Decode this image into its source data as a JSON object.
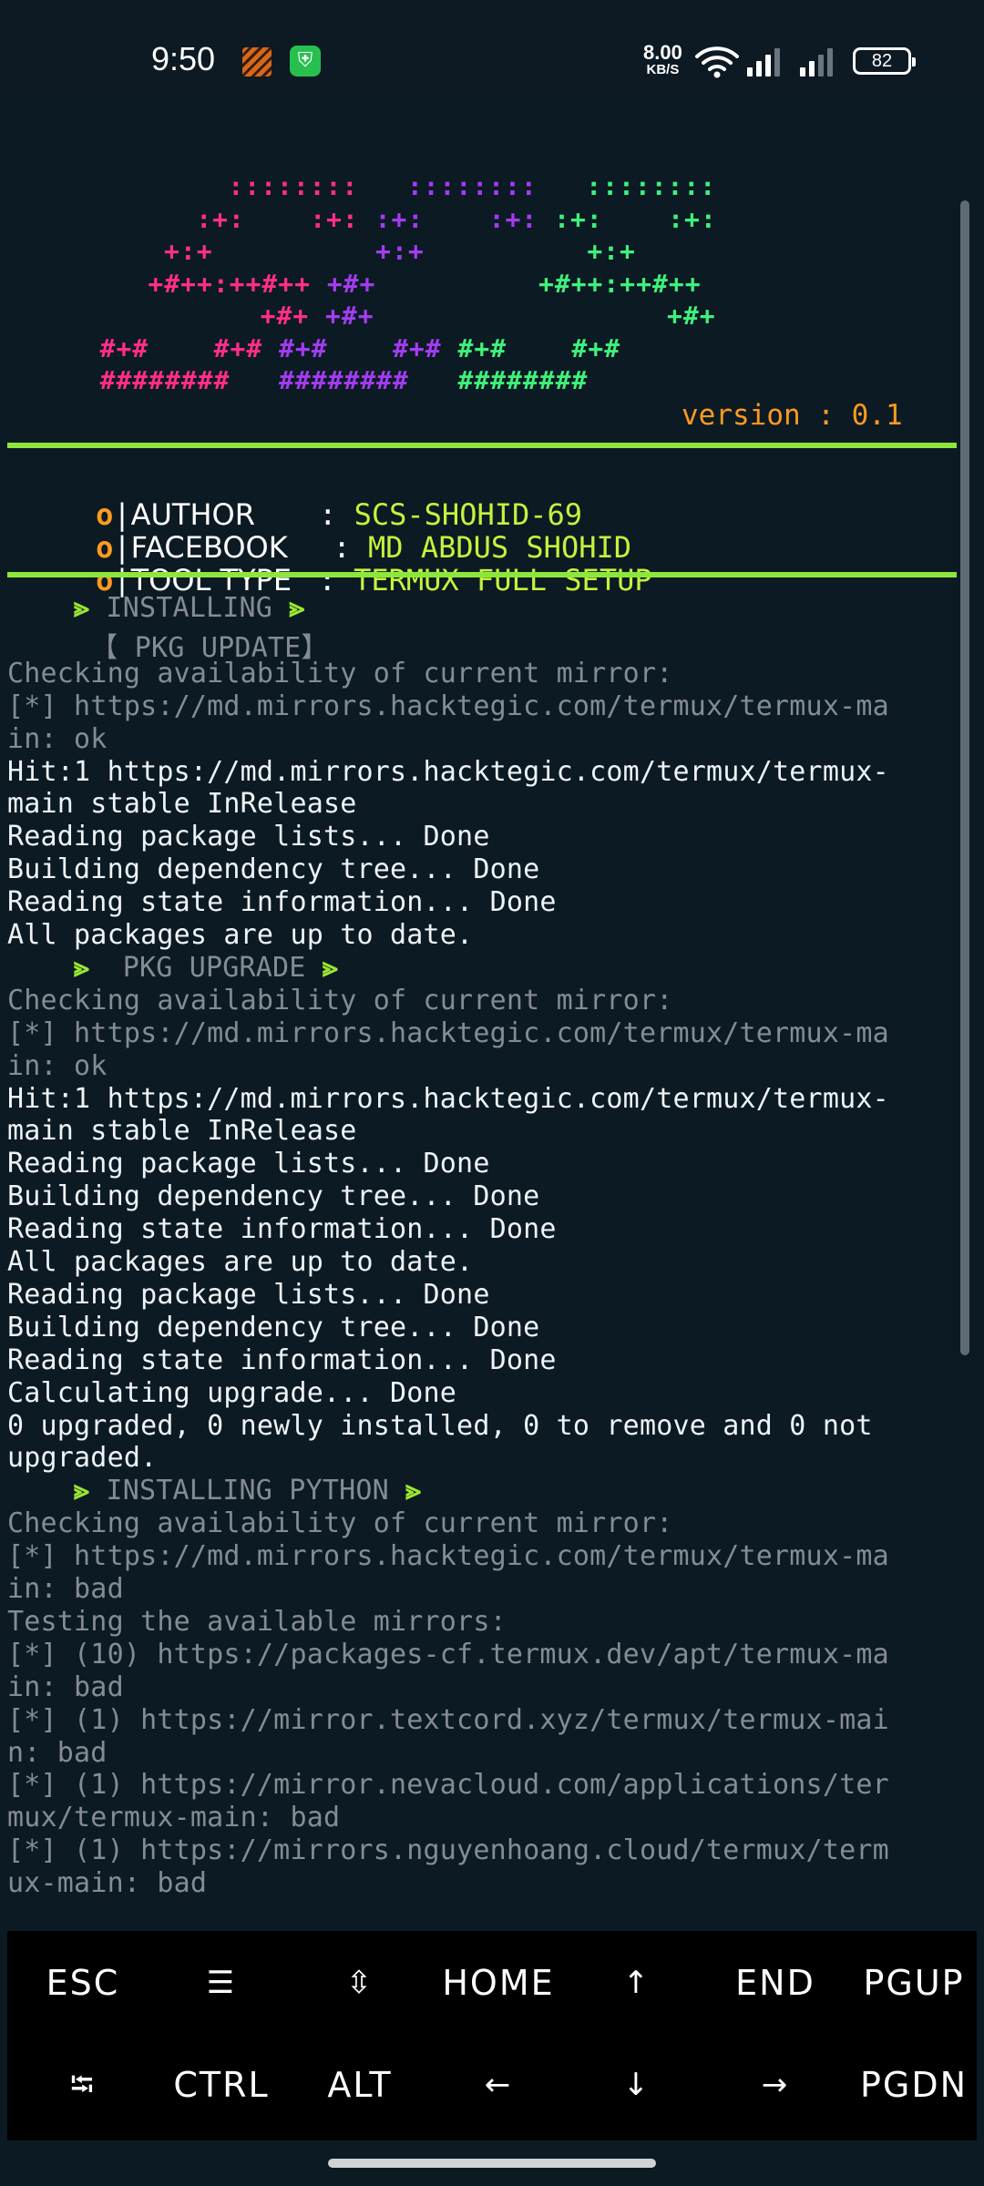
{
  "status_bar": {
    "time": "9:50",
    "net_speed_value": "8.00",
    "net_speed_unit": "KB/S",
    "battery": "82",
    "icons": [
      "striped-app-icon",
      "shield-app-icon",
      "wifi-icon",
      "signal-icon",
      "signal-icon-2",
      "battery-icon"
    ]
  },
  "banner": {
    "art_rows": [
      {
        "segments": [
          {
            "t": "::::::::",
            "c": "pink"
          },
          {
            "t": "   ",
            "c": ""
          },
          {
            "t": "::::::::",
            "c": "purple"
          },
          {
            "t": "   ",
            "c": ""
          },
          {
            "t": "::::::::",
            "c": "green"
          }
        ],
        "indent": 14
      },
      {
        "segments": [
          {
            "t": ":+:",
            "c": "pink"
          },
          {
            "t": "    ",
            "c": ""
          },
          {
            "t": ":+:",
            "c": "pink"
          },
          {
            "t": " ",
            "c": ""
          },
          {
            "t": ":+:",
            "c": "purple"
          },
          {
            "t": "    ",
            "c": ""
          },
          {
            "t": ":+:",
            "c": "purple"
          },
          {
            "t": " ",
            "c": ""
          },
          {
            "t": ":+:",
            "c": "green"
          },
          {
            "t": "    ",
            "c": ""
          },
          {
            "t": ":+:",
            "c": "green"
          }
        ],
        "indent": 12
      },
      {
        "segments": [
          {
            "t": "+:+",
            "c": "pink"
          },
          {
            "t": "          ",
            "c": ""
          },
          {
            "t": "+:+",
            "c": "purple"
          },
          {
            "t": "          ",
            "c": ""
          },
          {
            "t": "+:+",
            "c": "green"
          }
        ],
        "indent": 10
      },
      {
        "segments": [
          {
            "t": "+#++:++#++",
            "c": "pink"
          },
          {
            "t": " ",
            "c": ""
          },
          {
            "t": "+#+",
            "c": "purple"
          },
          {
            "t": "          ",
            "c": ""
          },
          {
            "t": "+#++:++#++",
            "c": "green"
          }
        ],
        "indent": 9
      },
      {
        "segments": [
          {
            "t": "+#+",
            "c": "pink"
          },
          {
            "t": " ",
            "c": ""
          },
          {
            "t": "+#+",
            "c": "purple"
          },
          {
            "t": "                  ",
            "c": ""
          },
          {
            "t": "+#+",
            "c": "green"
          }
        ],
        "indent": 16
      },
      {
        "segments": [
          {
            "t": "#+#",
            "c": "pink"
          },
          {
            "t": "    ",
            "c": ""
          },
          {
            "t": "#+#",
            "c": "pink"
          },
          {
            "t": " ",
            "c": ""
          },
          {
            "t": "#+#",
            "c": "purple"
          },
          {
            "t": "    ",
            "c": ""
          },
          {
            "t": "#+#",
            "c": "purple"
          },
          {
            "t": " ",
            "c": ""
          },
          {
            "t": "#+#",
            "c": "green"
          },
          {
            "t": "    ",
            "c": ""
          },
          {
            "t": "#+#",
            "c": "green"
          }
        ],
        "indent": 6
      },
      {
        "segments": [
          {
            "t": "########",
            "c": "pink"
          },
          {
            "t": "   ",
            "c": ""
          },
          {
            "t": "########",
            "c": "purple"
          },
          {
            "t": "   ",
            "c": ""
          },
          {
            "t": "########",
            "c": "green"
          }
        ],
        "indent": 6
      }
    ],
    "version": "version : 0.1"
  },
  "info": [
    {
      "key": "AUTHOR     ",
      "value": "SCS-SHOHID-69"
    },
    {
      "key": "FACEBOOK   ",
      "value": "MD ABDUS SHOHID"
    },
    {
      "key": "TOOL TYPE ",
      "value": "TERMUX FULL SETUP"
    }
  ],
  "terminal_lines": [
    {
      "text": "    ⪢ INSTALLING ⪢",
      "style": "head"
    },
    {
      "text": "     【 PKG UPDATE】",
      "style": "gray"
    },
    {
      "text": "Checking availability of current mirror:",
      "style": "gray"
    },
    {
      "text": "[*] https://md.mirrors.hacktegic.com/termux/termux-ma",
      "style": "gray"
    },
    {
      "text": "in: ok",
      "style": "gray"
    },
    {
      "text": "Hit:1 https://md.mirrors.hacktegic.com/termux/termux-",
      "style": "white"
    },
    {
      "text": "main stable InRelease",
      "style": "white"
    },
    {
      "text": "Reading package lists... Done",
      "style": "white"
    },
    {
      "text": "Building dependency tree... Done",
      "style": "white"
    },
    {
      "text": "Reading state information... Done",
      "style": "white"
    },
    {
      "text": "All packages are up to date.",
      "style": "white"
    },
    {
      "text": "    ⪢  PKG UPGRADE ⪢",
      "style": "head"
    },
    {
      "text": "Checking availability of current mirror:",
      "style": "gray"
    },
    {
      "text": "[*] https://md.mirrors.hacktegic.com/termux/termux-ma",
      "style": "gray"
    },
    {
      "text": "in: ok",
      "style": "gray"
    },
    {
      "text": "Hit:1 https://md.mirrors.hacktegic.com/termux/termux-",
      "style": "white"
    },
    {
      "text": "main stable InRelease",
      "style": "white"
    },
    {
      "text": "Reading package lists... Done",
      "style": "white"
    },
    {
      "text": "Building dependency tree... Done",
      "style": "white"
    },
    {
      "text": "Reading state information... Done",
      "style": "white"
    },
    {
      "text": "All packages are up to date.",
      "style": "white"
    },
    {
      "text": "Reading package lists... Done",
      "style": "white"
    },
    {
      "text": "Building dependency tree... Done",
      "style": "white"
    },
    {
      "text": "Reading state information... Done",
      "style": "white"
    },
    {
      "text": "Calculating upgrade... Done",
      "style": "white"
    },
    {
      "text": "0 upgraded, 0 newly installed, 0 to remove and 0 not",
      "style": "white"
    },
    {
      "text": "upgraded.",
      "style": "white"
    },
    {
      "text": "    ⪢ INSTALLING PYTHON ⪢",
      "style": "head"
    },
    {
      "text": "Checking availability of current mirror:",
      "style": "gray"
    },
    {
      "text": "[*] https://md.mirrors.hacktegic.com/termux/termux-ma",
      "style": "gray"
    },
    {
      "text": "in: bad",
      "style": "gray"
    },
    {
      "text": "Testing the available mirrors:",
      "style": "gray"
    },
    {
      "text": "[*] (10) https://packages-cf.termux.dev/apt/termux-ma",
      "style": "gray"
    },
    {
      "text": "in: bad",
      "style": "gray"
    },
    {
      "text": "[*] (1) https://mirror.textcord.xyz/termux/termux-mai",
      "style": "gray"
    },
    {
      "text": "n: bad",
      "style": "gray"
    },
    {
      "text": "[*] (1) https://mirror.nevacloud.com/applications/ter",
      "style": "gray"
    },
    {
      "text": "mux/termux-main: bad",
      "style": "gray"
    },
    {
      "text": "[*] (1) https://mirrors.nguyenhoang.cloud/termux/term",
      "style": "gray"
    },
    {
      "text": "ux-main: bad",
      "style": "gray"
    }
  ],
  "extra_keys": {
    "row1": [
      {
        "label": "ESC",
        "name": "esc-key"
      },
      {
        "label": "☰",
        "name": "menu-key"
      },
      {
        "label": "⇳",
        "name": "updown-key"
      },
      {
        "label": "HOME",
        "name": "home-key"
      },
      {
        "label": "↑",
        "name": "arrow-up-key"
      },
      {
        "label": "END",
        "name": "end-key"
      },
      {
        "label": "PGUP",
        "name": "pgup-key"
      }
    ],
    "row2": [
      {
        "label": "⭾",
        "name": "tab-key"
      },
      {
        "label": "CTRL",
        "name": "ctrl-key"
      },
      {
        "label": "ALT",
        "name": "alt-key"
      },
      {
        "label": "←",
        "name": "arrow-left-key"
      },
      {
        "label": "↓",
        "name": "arrow-down-key"
      },
      {
        "label": "→",
        "name": "arrow-right-key"
      },
      {
        "label": "PGDN",
        "name": "pgdn-key"
      }
    ]
  }
}
